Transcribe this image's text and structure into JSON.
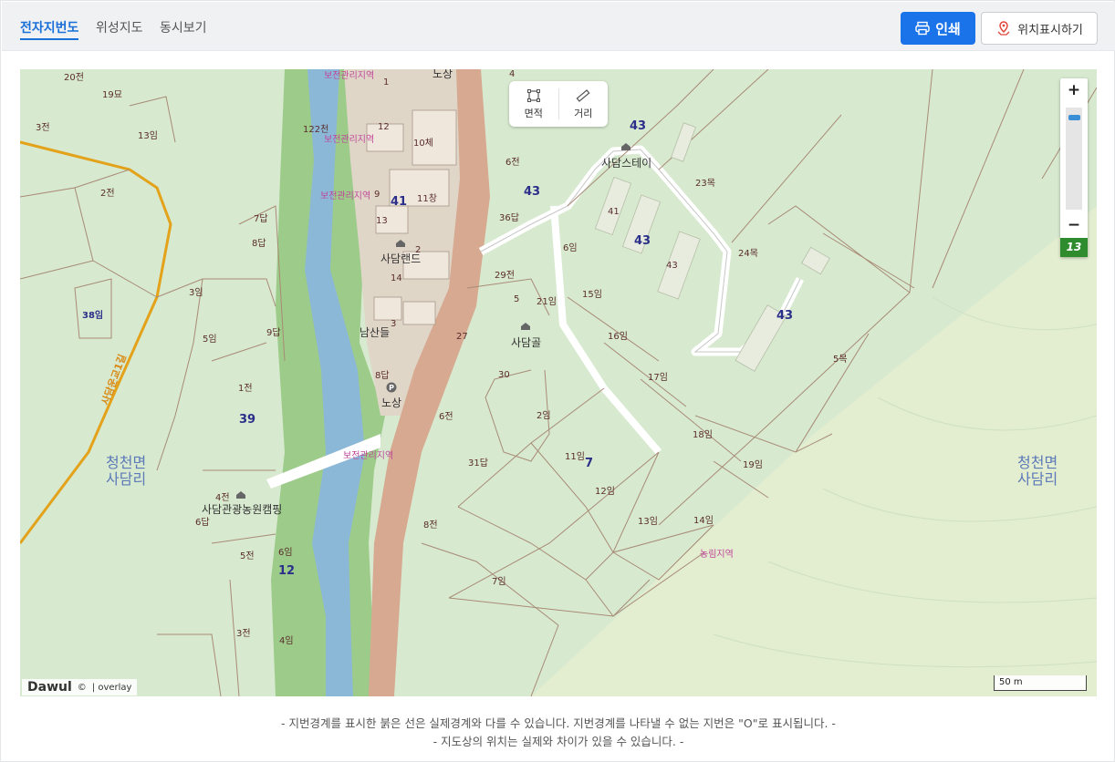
{
  "tabs": [
    {
      "label": "전자지번도",
      "active": true
    },
    {
      "label": "위성지도",
      "active": false
    },
    {
      "label": "동시보기",
      "active": false
    }
  ],
  "buttons": {
    "print": "인쇄",
    "location": "위치표시하기"
  },
  "tools": {
    "area": "면적",
    "distance": "거리"
  },
  "zoom": {
    "plus": "+",
    "minus": "−",
    "level": "13"
  },
  "branding": {
    "logo": "Dawul",
    "copyright": "©",
    "overlay": "| overlay"
  },
  "scale_label": "50 m",
  "notes": [
    "- 지번경계를 표시한 붉은 선은 실제경계와 다를 수 있습니다. 지번경계를 나타낼 수 없는 지번은 \"O\"로 표시됩니다. -",
    "- 지도상의 위치는 실제와 차이가 있을 수 있습니다. -"
  ],
  "map": {
    "towns": [
      {
        "text": "청천면\n사담리"
      },
      {
        "text": "청천면\n사담리"
      }
    ],
    "places": [
      "사담스테이",
      "사담랜드",
      "남산들",
      "사담골",
      "사담관광농원캠핑",
      "노상",
      "노상"
    ],
    "zones": [
      "보전관리지역",
      "보전관리지역",
      "보전관리지역",
      "보전관리지역",
      "농림지역"
    ],
    "road_name": "사담운교1길",
    "block_numbers": [
      "43",
      "41",
      "43",
      "43",
      "43",
      "39",
      "12",
      "7",
      "38임"
    ],
    "parcels": [
      "20전",
      "19묘",
      "3전",
      "13임",
      "2전",
      "7답",
      "8답",
      "3임",
      "5임",
      "9답",
      "1전",
      "4전",
      "6답",
      "5전",
      "6임",
      "3전",
      "4임",
      "1",
      "4",
      "12",
      "10체",
      "11창",
      "13",
      "9",
      "2",
      "14",
      "3",
      "8답",
      "6전",
      "6전",
      "36답",
      "29전",
      "5",
      "21임",
      "27",
      "30",
      "2임",
      "11임",
      "31답",
      "8전",
      "7임",
      "12임",
      "13임",
      "14임",
      "6임",
      "15임",
      "16임",
      "17임",
      "18임",
      "19임",
      "23목",
      "24목",
      "5목",
      "41",
      "43",
      "122천"
    ]
  }
}
